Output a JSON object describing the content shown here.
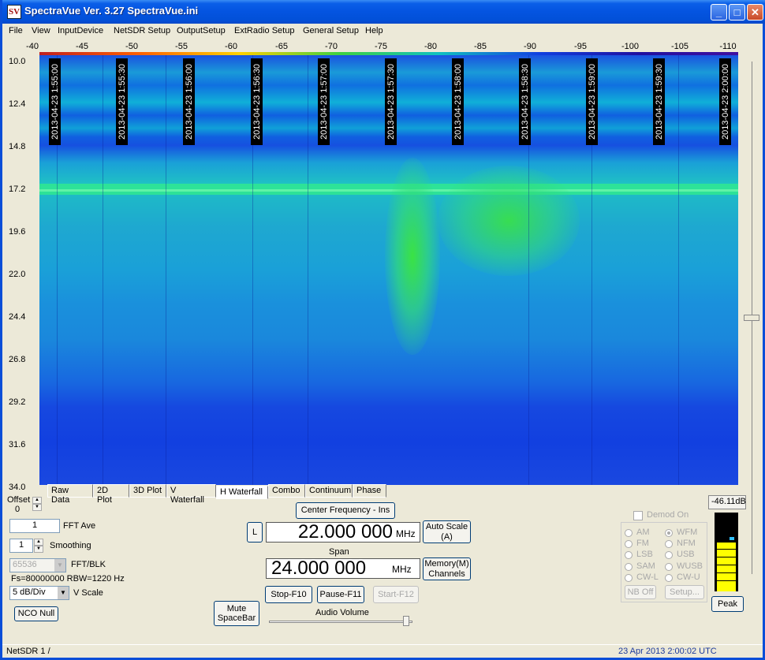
{
  "window": {
    "title": "SpectraVue Ver. 3.27  SpectraVue.ini",
    "icon_text": "SV",
    "min_glyph": "_",
    "max_glyph": "□",
    "close_glyph": "✕"
  },
  "menu": [
    "File",
    "View",
    "InputDevice",
    "NetSDR Setup",
    "OutputSetup",
    "ExtRadio Setup",
    "General Setup",
    "Help"
  ],
  "x_scale": [
    "-40",
    "-45",
    "-50",
    "-55",
    "-60",
    "-65",
    "-70",
    "-75",
    "-80",
    "-85",
    "-90",
    "-95",
    "-100",
    "-105",
    "-110"
  ],
  "y_scale": [
    "10.0",
    "12.4",
    "14.8",
    "17.2",
    "19.6",
    "22.0",
    "24.4",
    "26.8",
    "29.2",
    "31.6",
    "34.0"
  ],
  "timestamps": [
    "2013-04-23 1:55:00",
    "2013-04-23 1:55:30",
    "2013-04-23 1:56:00",
    "2013-04-23 1:56:30",
    "2013-04-23 1:57:00",
    "2013-04-23 1:57:30",
    "2013-04-23 1:58:00",
    "2013-04-23 1:58:30",
    "2013-04-23 1:59:00",
    "2013-04-23 1:59:30",
    "2013-04-23 2:00:00"
  ],
  "tabs": [
    "Raw Data",
    "2D Plot",
    "3D Plot",
    "V Waterfall",
    "H Waterfall",
    "Combo",
    "Continuum",
    "Phase"
  ],
  "active_tab": "H Waterfall",
  "controls": {
    "offset_label": "Offset",
    "offset_value": "0",
    "fft_ave_value": "1",
    "fft_ave_label": "FFT Ave",
    "smoothing_value": "1",
    "smoothing_label": "Smoothing",
    "fft_blk_value": "65536",
    "fft_blk_label": "FFT/BLK",
    "fs_text": "Fs=80000000 RBW=1220 Hz",
    "vscale_value": "5 dB/Div",
    "vscale_label": "V Scale",
    "nco_null": "NCO Null",
    "mute": "Mute\nSpaceBar",
    "center_freq_button": "Center Frequency - Ins",
    "l_button": "L",
    "center_freq_value": "22.000 000",
    "center_freq_unit": "MHz",
    "auto_scale": "Auto Scale\n(A)",
    "span_label": "Span",
    "span_value": "24.000 000",
    "span_unit": "MHz",
    "memory": "Memory(M)\nChannels",
    "stop": "Stop-F10",
    "pause": "Pause-F11",
    "start": "Start-F12",
    "audio_volume": "Audio Volume",
    "demod_on": "Demod On",
    "modes_left": [
      "AM",
      "FM",
      "LSB",
      "SAM",
      "CW-L"
    ],
    "modes_right": [
      "WFM",
      "NFM",
      "USB",
      "WUSB",
      "CW-U"
    ],
    "selected_mode": "WFM",
    "nb_off": "NB Off",
    "setup": "Setup...",
    "peak_db": "-46.11dB",
    "peak_button": "Peak"
  },
  "status": {
    "left": "NetSDR 1  /",
    "right": "23 Apr 2013  2:00:02 UTC"
  },
  "colors": {
    "title_bar": "#0454e0",
    "status_blue": "#1c3a9c"
  }
}
